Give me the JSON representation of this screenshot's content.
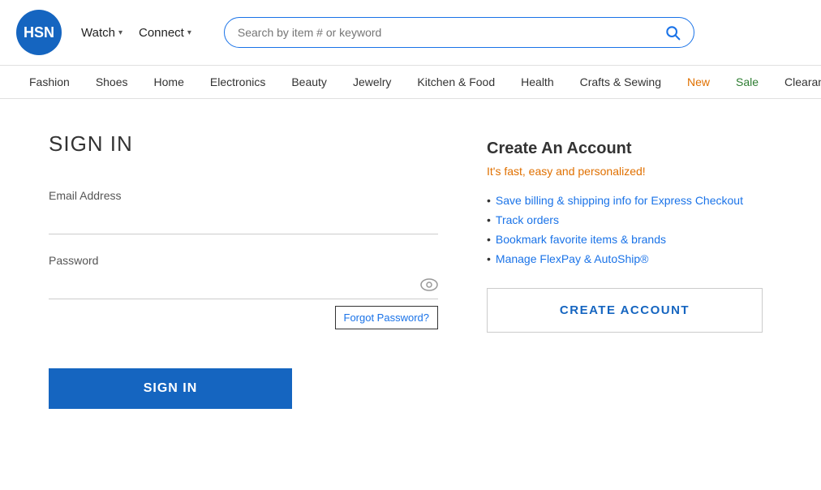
{
  "logo": {
    "text": "HSN"
  },
  "header": {
    "watch_label": "Watch",
    "connect_label": "Connect",
    "search_placeholder": "Search by item # or keyword"
  },
  "nav": {
    "items": [
      {
        "label": "Fashion",
        "color": "default"
      },
      {
        "label": "Shoes",
        "color": "default"
      },
      {
        "label": "Home",
        "color": "default"
      },
      {
        "label": "Electronics",
        "color": "default"
      },
      {
        "label": "Beauty",
        "color": "default"
      },
      {
        "label": "Jewelry",
        "color": "default"
      },
      {
        "label": "Kitchen & Food",
        "color": "default"
      },
      {
        "label": "Health",
        "color": "default"
      },
      {
        "label": "Crafts & Sewing",
        "color": "default"
      },
      {
        "label": "New",
        "color": "orange"
      },
      {
        "label": "Sale",
        "color": "green"
      },
      {
        "label": "Clearance",
        "color": "default"
      }
    ]
  },
  "signin": {
    "title": "SIGN IN",
    "email_label": "Email Address",
    "email_placeholder": "",
    "password_label": "Password",
    "password_placeholder": "",
    "forgot_password_label": "Forgot Password?",
    "signin_button_label": "SIGN IN"
  },
  "create_account": {
    "title": "Create An Account",
    "subtitle": "It's fast, easy and personalized!",
    "benefits": [
      "Save billing & shipping info for Express Checkout",
      "Track orders",
      "Bookmark favorite items & brands",
      "Manage FlexPay & AutoShip®"
    ],
    "button_label": "CREATE ACCOUNT"
  }
}
